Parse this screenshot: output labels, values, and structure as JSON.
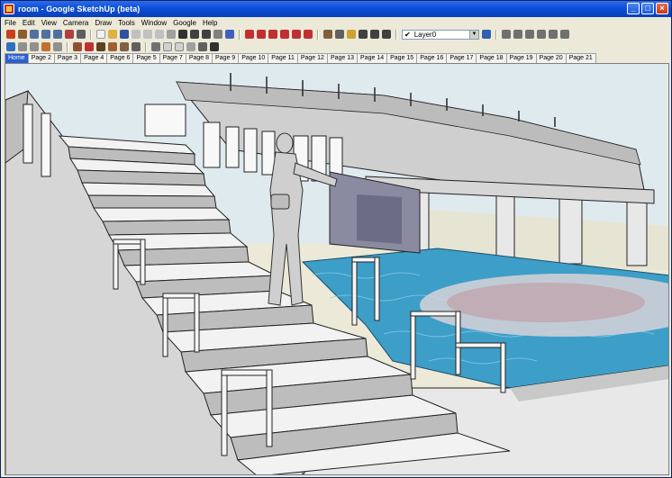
{
  "window": {
    "title": "room - Google SketchUp (beta)",
    "minimize": "_",
    "maximize": "□",
    "close": "×"
  },
  "menu": [
    "File",
    "Edit",
    "View",
    "Camera",
    "Draw",
    "Tools",
    "Window",
    "Google",
    "Help"
  ],
  "toolbar": {
    "layer_current": "Layer0",
    "layer_check": "✔"
  },
  "tabs": [
    "Home",
    "Page 2",
    "Page 3",
    "Page 4",
    "Page 6",
    "Page 5",
    "Page 7",
    "Page 8",
    "Page 9",
    "Page 10",
    "Page 11",
    "Page 12",
    "Page 13",
    "Page 14",
    "Page 15",
    "Page 16",
    "Page 17",
    "Page 18",
    "Page 19",
    "Page 20",
    "Page 21"
  ],
  "active_tab": "Home",
  "colors": {
    "sky": "#dde9ec",
    "water": "#3d9ec8",
    "concrete": "#e9e9e9",
    "shadow": "#b7b7b7",
    "edge": "#222222"
  }
}
